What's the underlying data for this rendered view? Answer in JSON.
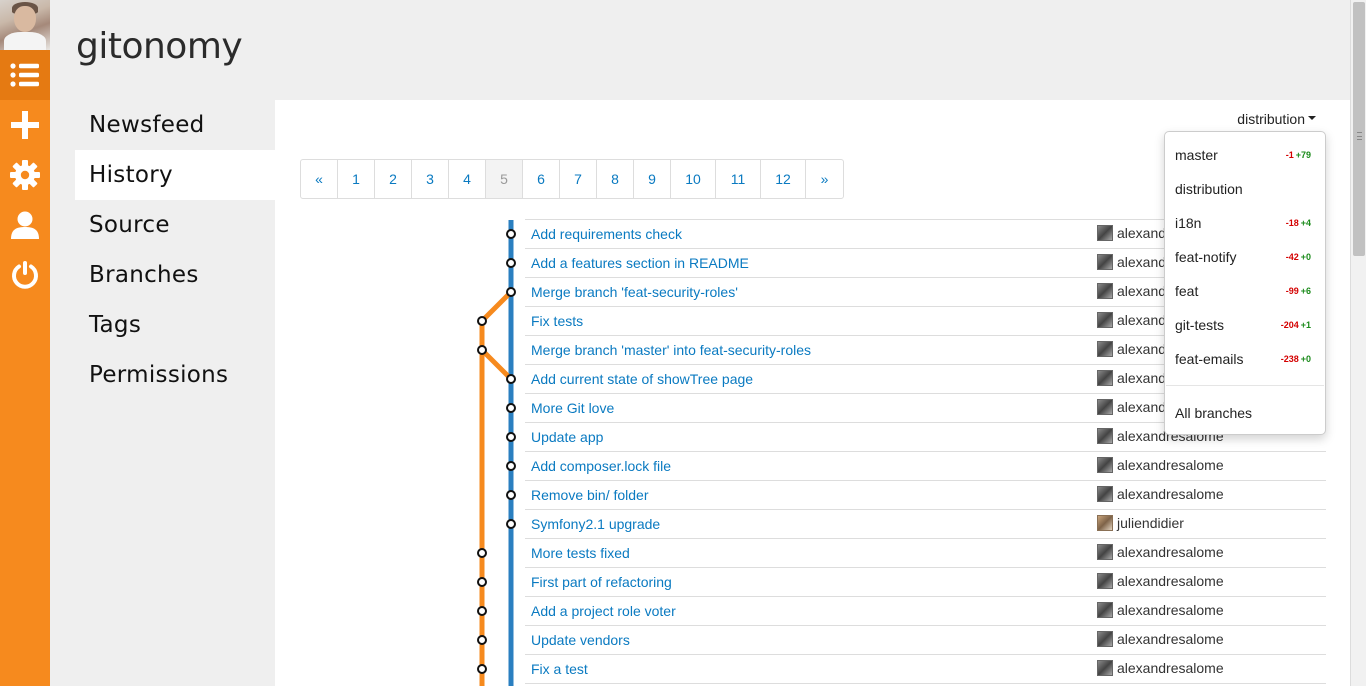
{
  "app": {
    "brand": "gitonomy"
  },
  "leftbar": {
    "items": [
      {
        "icon": "list-icon",
        "active": true
      },
      {
        "icon": "plus-icon",
        "active": false
      },
      {
        "icon": "gear-icon",
        "active": false
      },
      {
        "icon": "user-icon",
        "active": false
      },
      {
        "icon": "power-icon",
        "active": false
      }
    ]
  },
  "nav": {
    "items": [
      {
        "label": "Newsfeed"
      },
      {
        "label": "History"
      },
      {
        "label": "Source"
      },
      {
        "label": "Branches"
      },
      {
        "label": "Tags"
      },
      {
        "label": "Permissions"
      }
    ],
    "active": "History"
  },
  "branch_selector": {
    "current": "distribution"
  },
  "pagination": {
    "prev": "«",
    "next": "»",
    "pages": [
      "1",
      "2",
      "3",
      "4",
      "5",
      "6",
      "7",
      "8",
      "9",
      "10",
      "11",
      "12"
    ],
    "current": "5"
  },
  "branch_menu": {
    "items": [
      {
        "name": "master",
        "behind": "-1",
        "ahead": "+79"
      },
      {
        "name": "distribution",
        "behind": "",
        "ahead": ""
      },
      {
        "name": "i18n",
        "behind": "-18",
        "ahead": "+4"
      },
      {
        "name": "feat-notify",
        "behind": "-42",
        "ahead": "+0"
      },
      {
        "name": "feat",
        "behind": "-99",
        "ahead": "+6"
      },
      {
        "name": "git-tests",
        "behind": "-204",
        "ahead": "+1"
      },
      {
        "name": "feat-emails",
        "behind": "-238",
        "ahead": "+0"
      }
    ],
    "all_label": "All branches"
  },
  "commits": [
    {
      "message": "Add requirements check",
      "author": "alexand"
    },
    {
      "message": "Add a features section in README",
      "author": "alexand"
    },
    {
      "message": "Merge branch 'feat-security-roles'",
      "author": "alexand"
    },
    {
      "message": "Fix tests",
      "author": "alexand"
    },
    {
      "message": "Merge branch 'master' into feat-security-roles",
      "author": "alexand"
    },
    {
      "message": "Add current state of showTree page",
      "author": "alexand"
    },
    {
      "message": "More Git love",
      "author": "alexand"
    },
    {
      "message": "Update app",
      "author": "alexandresalome"
    },
    {
      "message": "Add composer.lock file",
      "author": "alexandresalome"
    },
    {
      "message": "Remove bin/ folder",
      "author": "alexandresalome"
    },
    {
      "message": "Symfony2.1 upgrade",
      "author": "juliendidier"
    },
    {
      "message": "More tests fixed",
      "author": "alexandresalome"
    },
    {
      "message": "First part of refactoring",
      "author": "alexandresalome"
    },
    {
      "message": "Add a project role voter",
      "author": "alexandresalome"
    },
    {
      "message": "Update vendors",
      "author": "alexandresalome"
    },
    {
      "message": "Fix a test",
      "author": "alexandresalome"
    }
  ],
  "colors": {
    "accent": "#f68a1e",
    "accent_dark": "#e57a12",
    "link": "#0a7ac1",
    "graph_main": "#2a7fc0",
    "graph_branch": "#f68a1e"
  }
}
